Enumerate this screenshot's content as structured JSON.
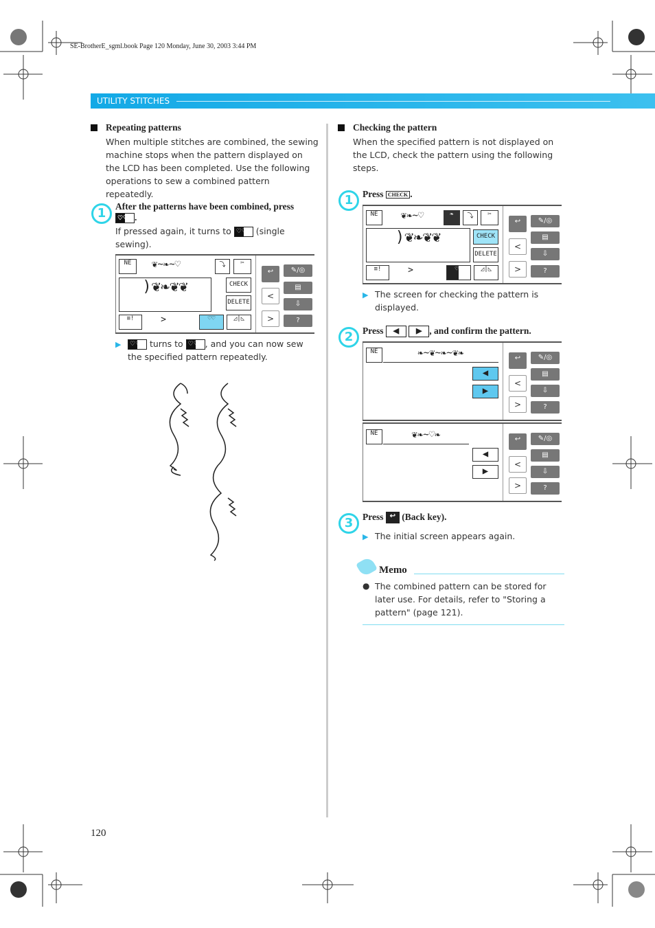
{
  "meta": "SE-BrotherE_sgml.book  Page 120  Monday, June 30, 2003  3:44 PM",
  "header": "UTILITY STITCHES",
  "left": {
    "title": "Repeating patterns",
    "intro": "When multiple stitches are combined, the sewing machine stops when the pattern displayed on the LCD has been completed. Use the following operations to sew a combined pattern repeatedly.",
    "step1": {
      "num": "1",
      "title": "After the patterns have been combined, press",
      "title_end": ".",
      "note_a": "If pressed again, it turns to",
      "note_b": "(single sewing)."
    },
    "result_a": "turns to",
    "result_b": ", and you can now sew the specified pattern repeatedly."
  },
  "right": {
    "title": "Checking the pattern",
    "intro": "When the specified pattern is not displayed on the LCD, check the pattern using the following steps.",
    "step1": {
      "num": "1",
      "press": "Press",
      "key": "CHECK",
      "end": ".",
      "result": "The screen for checking the pattern is displayed."
    },
    "step2": {
      "num": "2",
      "press": "Press",
      "text": ", and confirm the pattern."
    },
    "step3": {
      "num": "3",
      "press": "Press",
      "text": "(Back key).",
      "result": "The initial screen appears again."
    },
    "memo": {
      "title": "Memo",
      "text": "The combined pattern can be stored for later use. For details, refer to \"Storing a pattern\" (page 121)."
    }
  },
  "lcd": {
    "check": "CHECK",
    "delete": "DELETE",
    "ne": "NE"
  },
  "page_number": "120",
  "colors": {
    "accent": "#1ab0e8",
    "step": "#2fd4e8"
  }
}
